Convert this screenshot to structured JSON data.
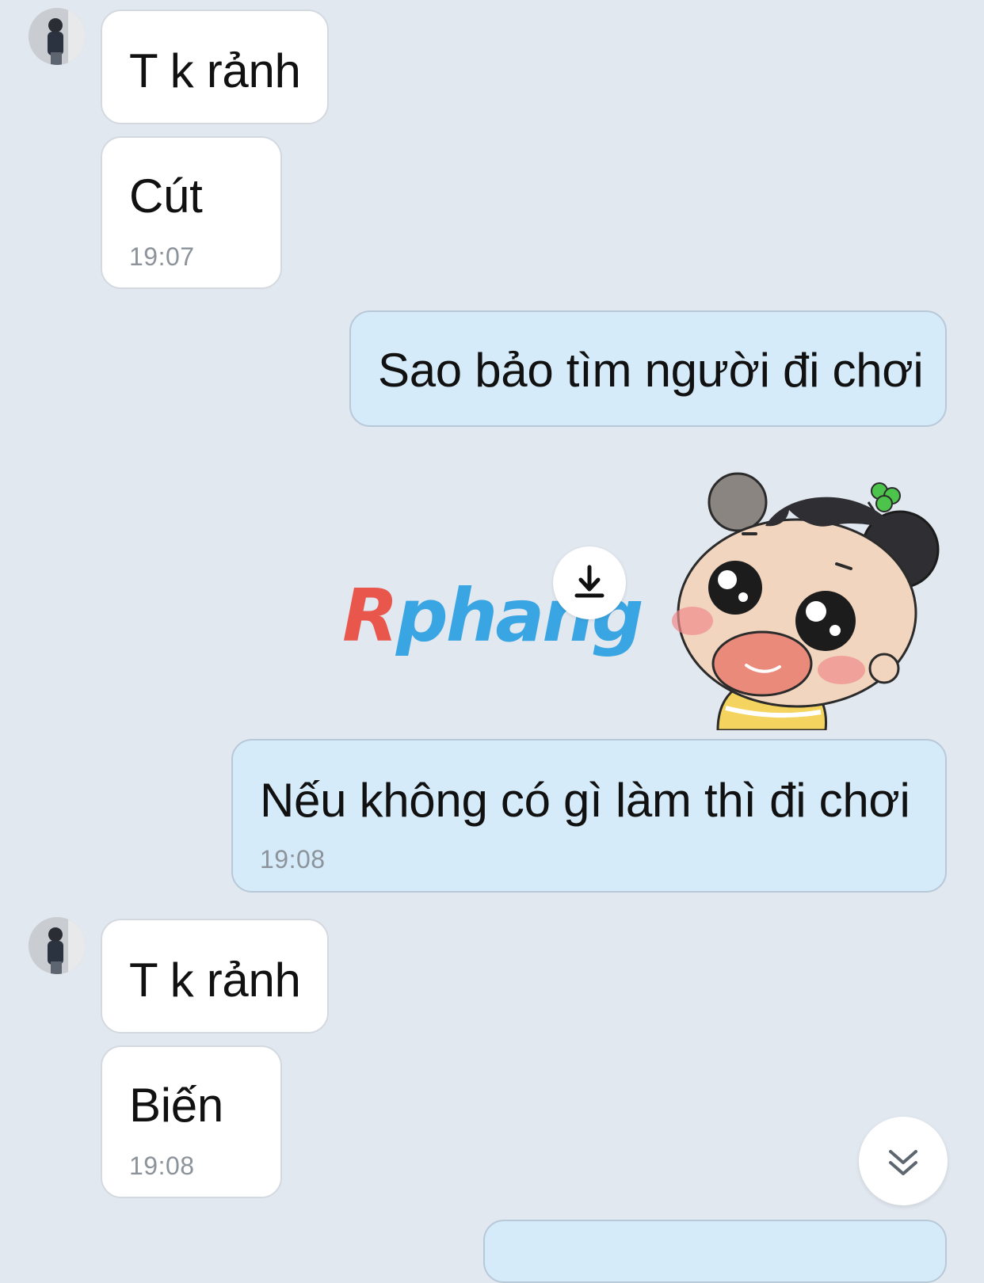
{
  "messages": [
    {
      "sender": "contact",
      "text": "T k rảnh",
      "time": ""
    },
    {
      "sender": "contact",
      "text": "Cút",
      "time": "19:07"
    },
    {
      "sender": "me",
      "text": "Sao bảo tìm người đi chơi",
      "time": ""
    },
    {
      "sender": "me",
      "type": "sticker",
      "icon": "crying-girl-sticker"
    },
    {
      "sender": "me",
      "text": "Nếu không có gì làm thì đi chơi",
      "time": "19:08"
    },
    {
      "sender": "contact",
      "text": "T k rảnh",
      "time": ""
    },
    {
      "sender": "contact",
      "text": "Biến",
      "time": "19:08"
    }
  ],
  "watermark": {
    "first": "R",
    "rest": "phang"
  },
  "icons": {
    "download": "download-icon",
    "scroll_down": "double-chevron-down-icon",
    "avatar": "contact-avatar"
  },
  "colors": {
    "background": "#e2e8f0",
    "incoming_bubble": "#ffffff",
    "outgoing_bubble": "#d6ebf9",
    "timestamp": "#8c939b"
  }
}
